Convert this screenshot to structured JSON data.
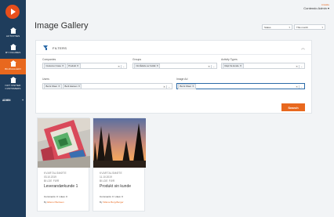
{
  "sidebar": {
    "items": [
      {
        "label": "Activities",
        "icon": "home-icon"
      },
      {
        "label": "My figures",
        "icon": "home-icon"
      },
      {
        "label": "Bildgalleri",
        "icon": "home-icon",
        "active": true
      },
      {
        "label": "Not visited customers",
        "icon": "home-icon"
      }
    ],
    "admin_label": "ADMIN",
    "admin_toggle": "+"
  },
  "header": {
    "user_role": "Ansatte",
    "user_name": "Contendo Admin",
    "title": "Image Gallery",
    "status_select": "Status",
    "period_select": "This month"
  },
  "filters": {
    "title": "FILTERS",
    "companies": {
      "label": "Companies",
      "chips": [
        "Customer Case",
        "Produkt"
      ]
    },
    "groups": {
      "label": "Groups",
      "chips": [
        "Områdebe av butikk"
      ]
    },
    "activity_types": {
      "label": "Activity Types",
      "chips": [
        "Rapi fra kunde"
      ]
    },
    "users": {
      "label": "Users",
      "chips": [
        "Berni Olsen",
        "Berit Hansen"
      ]
    },
    "image_ad": {
      "label": "Image Ad",
      "chips": [
        "Berni Olsen"
      ]
    },
    "search_label": "Search"
  },
  "cards": [
    {
      "category": "KVARTALSMØTE",
      "date": "03.10.2019",
      "type": "BILDE FØR",
      "title": "Leverandørkunde 1",
      "comments": "Comments: 0",
      "likes": "Likes: 0",
      "by_prefix": "By",
      "author": "Ellenor Berkeen"
    },
    {
      "category": "KVARTALSMØTE",
      "date": "11.10.2019",
      "type": "BILDE FØR",
      "title": "Produkt sin kunde",
      "comments": "Comments: 0",
      "likes": "Likes: 0",
      "by_prefix": "By",
      "author": "Sillene Berg-Berger"
    }
  ],
  "colors": {
    "sidebar": "#1f3d5c",
    "accent": "#e8681e",
    "link": "#2b6aa8"
  }
}
